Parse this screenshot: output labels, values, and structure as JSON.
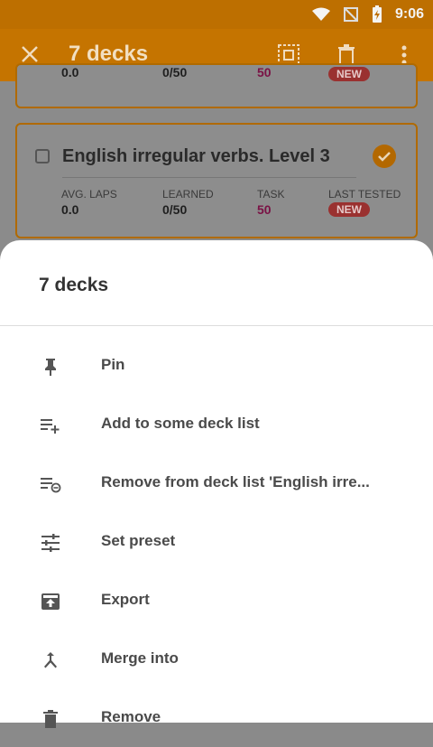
{
  "status_bar": {
    "time": "9:06"
  },
  "app_bar": {
    "title": "7 decks"
  },
  "background_cards": [
    {
      "avg_laps": "0.0",
      "learned": "0/50",
      "task": "50",
      "badge": "NEW"
    },
    {
      "title": "English irregular verbs. Level 3",
      "labels": {
        "avg_laps": "AVG. LAPS",
        "learned": "LEARNED",
        "task": "TASK",
        "last_tested": "LAST TESTED"
      },
      "avg_laps": "0.0",
      "learned": "0/50",
      "task": "50",
      "badge": "NEW"
    }
  ],
  "sheet": {
    "title": "7 decks",
    "items": [
      {
        "label": "Pin",
        "icon": "pin-icon"
      },
      {
        "label": "Add to some deck list",
        "icon": "playlist-add-icon"
      },
      {
        "label": "Remove from deck list 'English irre...",
        "icon": "playlist-remove-icon"
      },
      {
        "label": "Set preset",
        "icon": "tune-icon"
      },
      {
        "label": "Export",
        "icon": "export-icon"
      },
      {
        "label": "Merge into",
        "icon": "merge-icon"
      },
      {
        "label": "Remove",
        "icon": "delete-icon"
      }
    ]
  },
  "colors": {
    "accent": "#c57400",
    "sheet_handle": "#e58a10",
    "badge": "#9a3130"
  }
}
